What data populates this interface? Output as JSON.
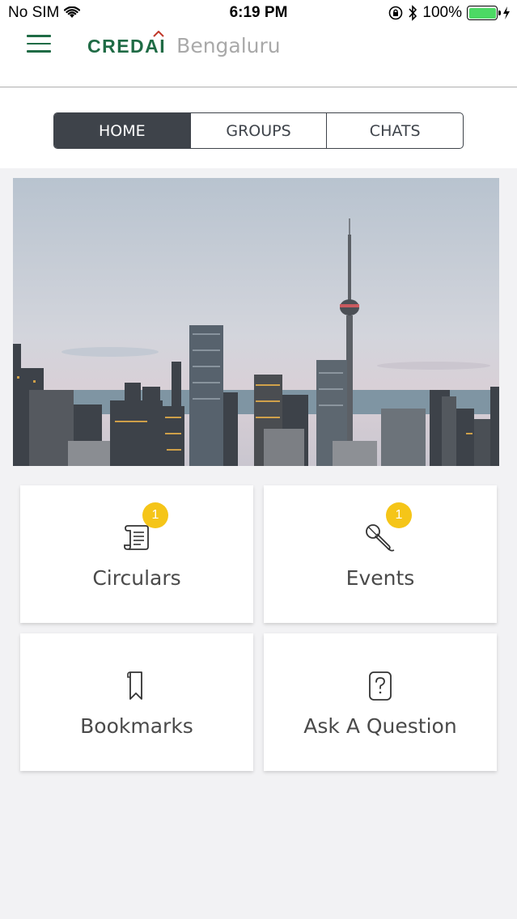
{
  "status_bar": {
    "carrier": "No SIM",
    "time": "6:19 PM",
    "battery": "100%",
    "battery_level": 1.0
  },
  "header": {
    "logo_text": "CREDAI",
    "city": "Bengaluru",
    "brand_color": "#1f6b45"
  },
  "tabs": [
    {
      "label": "HOME",
      "active": true
    },
    {
      "label": "GROUPS",
      "active": false
    },
    {
      "label": "CHATS",
      "active": false
    }
  ],
  "tiles": [
    {
      "label": "Circulars",
      "icon": "scroll-icon",
      "badge": "1"
    },
    {
      "label": "Events",
      "icon": "microphone-icon",
      "badge": "1"
    },
    {
      "label": "Bookmarks",
      "icon": "bookmark-icon",
      "badge": null
    },
    {
      "label": "Ask A Question",
      "icon": "question-icon",
      "badge": null
    }
  ],
  "colors": {
    "badge": "#f5c518",
    "tab_active": "#3e434a"
  }
}
